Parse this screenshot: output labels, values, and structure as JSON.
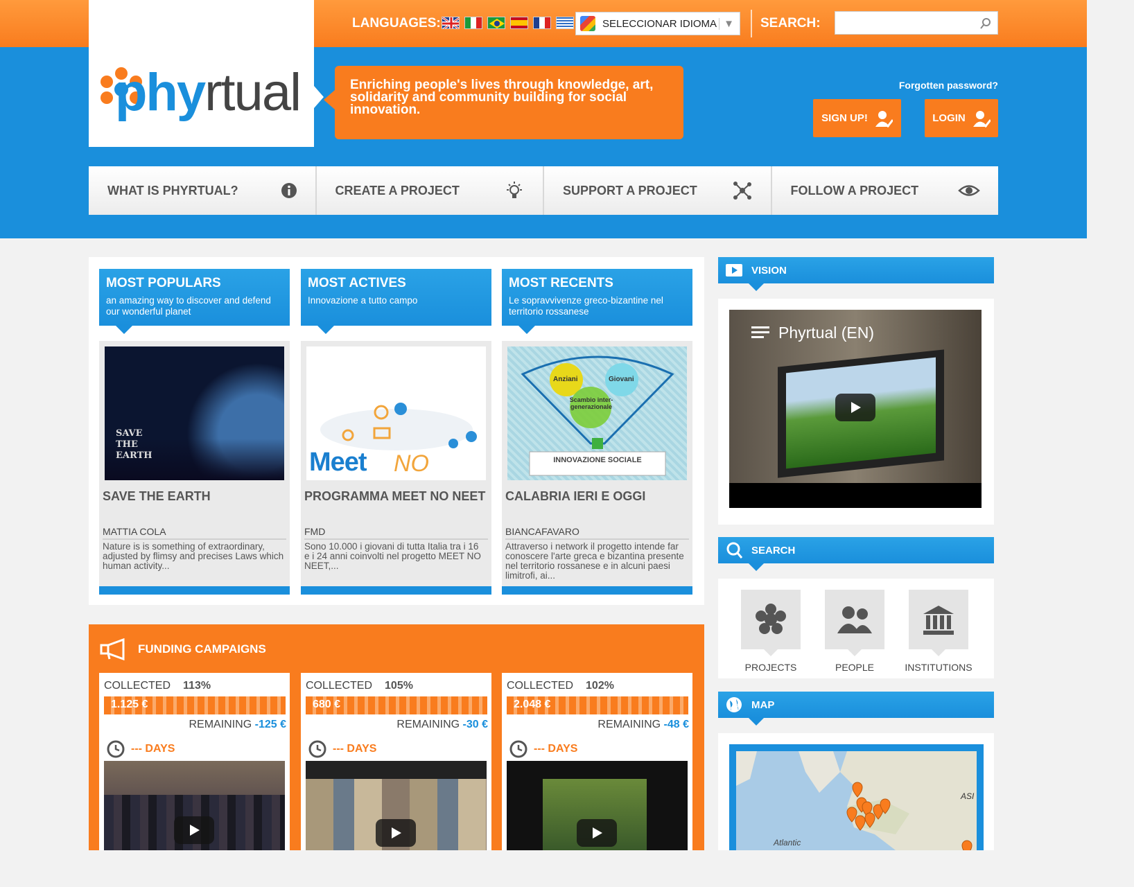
{
  "header": {
    "languages_label": "LANGUAGES:",
    "language_select": "SELECCIONAR IDIOMA",
    "search_label": "SEARCH:",
    "search_placeholder": "",
    "logo_text_p": "phy",
    "logo_text_rest": "rtual",
    "tagline": "Enriching people's lives through knowledge, art, solidarity and community building for social innovation.",
    "forgot_password": "Forgotten password?",
    "signup": "SIGN UP!",
    "login": "LOGIN"
  },
  "nav": [
    {
      "label": "WHAT IS PHYRTUAL?",
      "icon": "info-icon"
    },
    {
      "label": "CREATE A PROJECT",
      "icon": "lightbulb-icon"
    },
    {
      "label": "SUPPORT A PROJECT",
      "icon": "network-icon"
    },
    {
      "label": "FOLLOW A PROJECT",
      "icon": "eye-icon"
    }
  ],
  "categories": [
    {
      "title": "MOST POPULARS",
      "subtitle": "an amazing way to discover and defend our wonderful planet",
      "project": "SAVE THE EARTH",
      "author": "MATTIA COLA",
      "desc": "Nature is is something of extraordinary, adjusted by flimsy and precises Laws which human activity...",
      "img_text": "SAVE THE EARTH"
    },
    {
      "title": "MOST ACTIVES",
      "subtitle": "Innovazione a tutto campo",
      "project": "PROGRAMMA MEET NO NEET",
      "author": "FMD",
      "desc": "Sono 10.000 i giovani di tutta Italia tra i 16 e i 24 anni coinvolti nel progetto MEET NO NEET,...",
      "img_text_a": "Meet",
      "img_text_b": "NO NEET"
    },
    {
      "title": "MOST RECENTS",
      "subtitle": "Le sopravvivenze greco-bizantine nel territorio rossanese",
      "project": "CALABRIA IERI E OGGI",
      "author": "BIANCAFAVARO",
      "desc": "Attraverso i network il progetto intende far conoscere l'arte greca e bizantina presente nel territorio rossanese e in alcuni paesi limitrofi, ai...",
      "img_text_a": "Anziani",
      "img_text_b": "Giovani",
      "img_text_c": "Scambio inter-generazionale",
      "img_text_d": "INNOVAZIONE SOCIALE"
    }
  ],
  "funding": {
    "title": "FUNDING CAMPAIGNS",
    "collected_label": "COLLECTED",
    "remaining_label": "REMAINING",
    "days_label": "--- DAYS",
    "campaigns": [
      {
        "percent": "113%",
        "amount": "1.125 €",
        "remaining": "-125 €"
      },
      {
        "percent": "105%",
        "amount": "680 €",
        "remaining": "-30 €"
      },
      {
        "percent": "102%",
        "amount": "2.048 €",
        "remaining": "-48 €"
      }
    ]
  },
  "sidebar": {
    "vision_title": "VISION",
    "video_title": "Phyrtual (EN)",
    "search_title": "SEARCH",
    "search_options": [
      "PROJECTS",
      "PEOPLE",
      "INSTITUTIONS"
    ],
    "map_title": "MAP",
    "map_label_atlantic": "Atlantic",
    "map_label_asia": "ASI"
  },
  "colors": {
    "orange": "#f97c1e",
    "blue": "#1a8fdc"
  }
}
